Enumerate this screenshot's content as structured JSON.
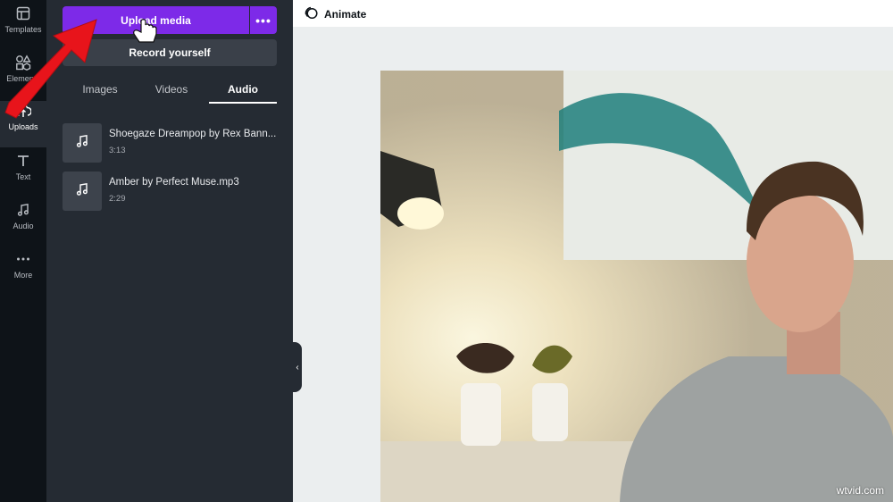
{
  "sidebar": {
    "items": [
      {
        "label": "Templates",
        "icon": "templates-icon"
      },
      {
        "label": "Elements",
        "icon": "elements-icon"
      },
      {
        "label": "Uploads",
        "icon": "uploads-icon",
        "active": true
      },
      {
        "label": "Text",
        "icon": "text-icon"
      },
      {
        "label": "Audio",
        "icon": "audio-icon"
      },
      {
        "label": "More",
        "icon": "more-dots-icon"
      }
    ]
  },
  "panel": {
    "upload_label": "Upload media",
    "more_label": "•••",
    "record_label": "Record yourself",
    "tabs": [
      {
        "label": "Images"
      },
      {
        "label": "Videos"
      },
      {
        "label": "Audio",
        "active": true
      }
    ],
    "tracks": [
      {
        "name": "Shoegaze Dreampop by Rex Bann...",
        "duration": "3:13"
      },
      {
        "name": "Amber by Perfect Muse.mp3",
        "duration": "2:29"
      }
    ]
  },
  "toolbar": {
    "animate_label": "Animate"
  },
  "watermark": "wtvid.com",
  "colors": {
    "accent": "#7d2ae8",
    "rail_bg": "#0e1318",
    "panel_bg": "#252b33",
    "annotation_arrow": "#e8141b"
  }
}
